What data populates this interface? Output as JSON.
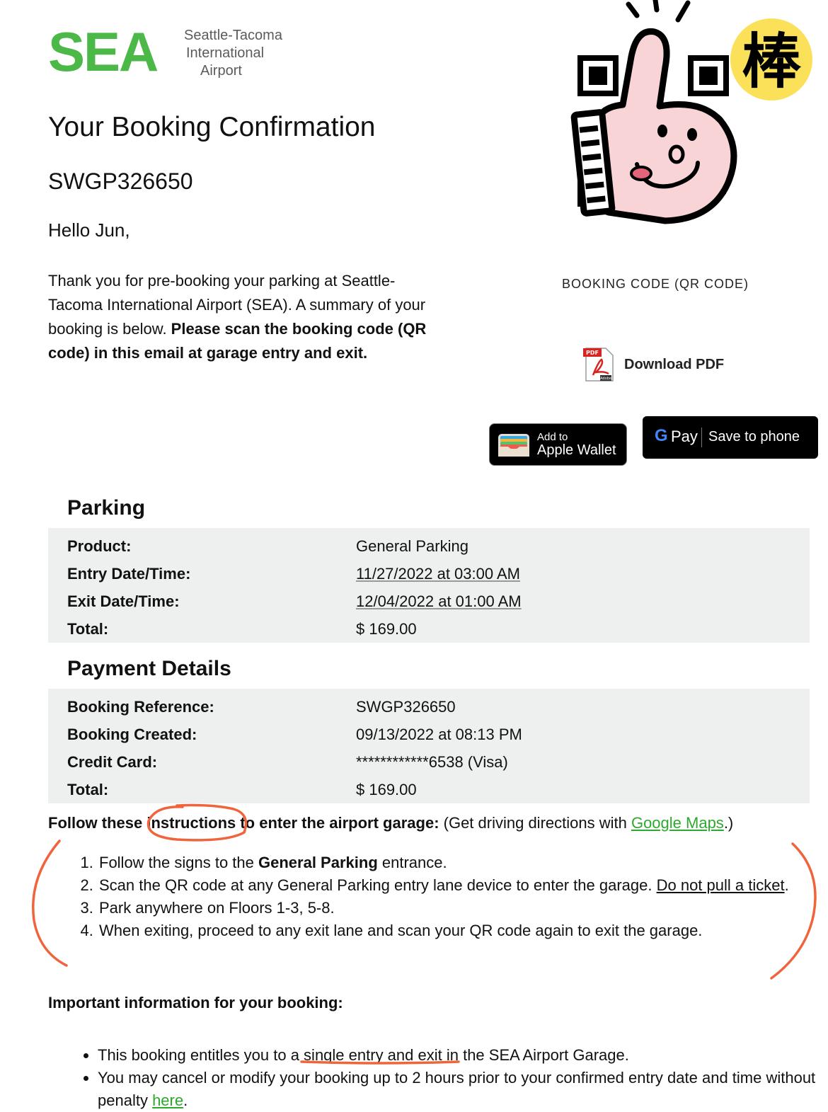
{
  "logo": {
    "mark": "SEA",
    "line1": "Seattle-Tacoma",
    "line2": "International",
    "line3": "Airport"
  },
  "header": {
    "title": "Your Booking Confirmation",
    "reference": "SWGP326650",
    "greeting": "Hello Jun,",
    "intro_plain": "Thank you for pre-booking your parking at Seattle-Tacoma International Airport (SEA). A summary of your booking is below. ",
    "intro_bold": "Please scan the booking code (QR code) in this email at garage entry and exit."
  },
  "qr": {
    "label": "BOOKING CODE (QR CODE)",
    "sticker_text": "棒"
  },
  "actions": {
    "pdf_badge": "PDF",
    "pdf_brand": "Adobe",
    "download_pdf": "Download PDF",
    "wallet_small": "Add to",
    "wallet_big": "Apple Wallet",
    "gpay_g": "G",
    "gpay_pay": "Pay",
    "gpay_save": "Save to phone"
  },
  "parking": {
    "heading": "Parking",
    "rows": [
      {
        "key": "Product:",
        "value": "General Parking"
      },
      {
        "key": "Entry Date/Time:",
        "value": "11/27/2022 at 03:00 AM"
      },
      {
        "key": "Exit Date/Time:",
        "value": "12/04/2022 at 01:00 AM"
      },
      {
        "key": "Total:",
        "value": "$ 169.00"
      }
    ]
  },
  "payment": {
    "heading": "Payment Details",
    "rows": [
      {
        "key": "Booking Reference:",
        "value": "SWGP326650"
      },
      {
        "key": "Booking Created:",
        "value": "09/13/2022 at 08:13 PM"
      },
      {
        "key": "Credit Card:",
        "value": "************6538 (Visa)"
      },
      {
        "key": "Total:",
        "value": "$ 169.00"
      }
    ]
  },
  "instructions": {
    "lead_bold": "Follow these instructions to enter the airport garage:",
    "lead_plain": " (Get driving directions with ",
    "maps_link": "Google Maps",
    "lead_end": ".)",
    "step1_a": "Follow the signs to the ",
    "step1_b": "General Parking",
    "step1_c": " entrance.",
    "step2_a": "Scan the QR code at any General Parking entry lane device to enter the garage. ",
    "step2_b": "Do not pull a ticket",
    "step2_c": ".",
    "step3": "Park anywhere on Floors 1-3, 5-8.",
    "step4": "When exiting, proceed to any exit lane and scan your QR code again to exit the garage."
  },
  "important": {
    "heading": "Important information for your booking:",
    "bullet1": "This booking entitles you to a single entry and exit in the SEA Airport Garage.",
    "bullet2_a": "You may cancel or modify your booking up to 2 hours prior to your confirmed entry date and time without penalty ",
    "bullet2_link": "here",
    "bullet2_end": "."
  },
  "colors": {
    "brand_green": "#4cb848",
    "link_green": "#2ea82e",
    "annotation_orange": "#f0643c",
    "table_bg": "#eef0ef"
  }
}
